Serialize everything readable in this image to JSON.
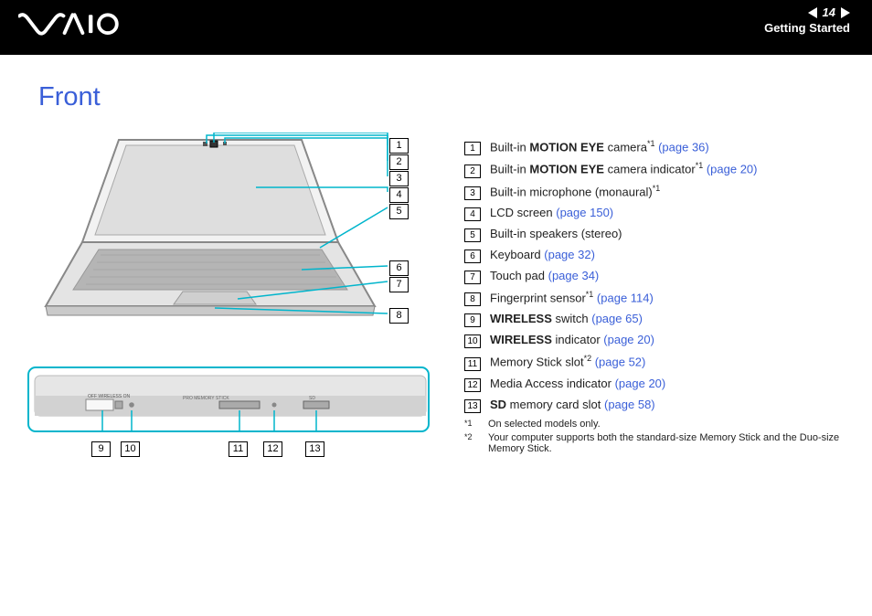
{
  "header": {
    "logo": "VAIO",
    "page_number": "14",
    "section": "Getting Started"
  },
  "title": "Front",
  "items": [
    {
      "num": "1",
      "pre": "Built-in ",
      "bold": "MOTION EYE",
      "post": " camera",
      "sup": "*1",
      "link": "(page 36)"
    },
    {
      "num": "2",
      "pre": "Built-in ",
      "bold": "MOTION EYE",
      "post": " camera indicator",
      "sup": "*1",
      "link": "(page 20)"
    },
    {
      "num": "3",
      "pre": "Built-in microphone (monaural)",
      "bold": "",
      "post": "",
      "sup": "*1",
      "link": ""
    },
    {
      "num": "4",
      "pre": "LCD screen ",
      "bold": "",
      "post": "",
      "sup": "",
      "link": "(page 150)"
    },
    {
      "num": "5",
      "pre": "Built-in speakers (stereo)",
      "bold": "",
      "post": "",
      "sup": "",
      "link": ""
    },
    {
      "num": "6",
      "pre": "Keyboard ",
      "bold": "",
      "post": "",
      "sup": "",
      "link": "(page 32)"
    },
    {
      "num": "7",
      "pre": "Touch pad ",
      "bold": "",
      "post": "",
      "sup": "",
      "link": "(page 34)"
    },
    {
      "num": "8",
      "pre": "Fingerprint sensor",
      "bold": "",
      "post": "",
      "sup": "*1",
      "link": "(page 114)"
    },
    {
      "num": "9",
      "pre": "",
      "bold": "WIRELESS",
      "post": " switch ",
      "sup": "",
      "link": "(page 65)"
    },
    {
      "num": "10",
      "pre": "",
      "bold": "WIRELESS",
      "post": " indicator ",
      "sup": "",
      "link": "(page 20)"
    },
    {
      "num": "11",
      "pre": "Memory Stick slot",
      "bold": "",
      "post": "",
      "sup": "*2",
      "link": "(page 52)"
    },
    {
      "num": "12",
      "pre": "Media Access indicator ",
      "bold": "",
      "post": "",
      "sup": "",
      "link": "(page 20)"
    },
    {
      "num": "13",
      "pre": "",
      "bold": "SD",
      "post": " memory card slot ",
      "sup": "",
      "link": "(page 58)"
    }
  ],
  "footnotes": [
    {
      "key": "*1",
      "text": "On selected models only."
    },
    {
      "key": "*2",
      "text": "Your computer supports both the standard-size Memory Stick and the Duo-size Memory Stick."
    }
  ],
  "callouts_top": [
    "1",
    "2",
    "3",
    "4",
    "5",
    "6",
    "7",
    "8"
  ],
  "callouts_bottom": [
    "9",
    "10",
    "11",
    "12",
    "13"
  ]
}
